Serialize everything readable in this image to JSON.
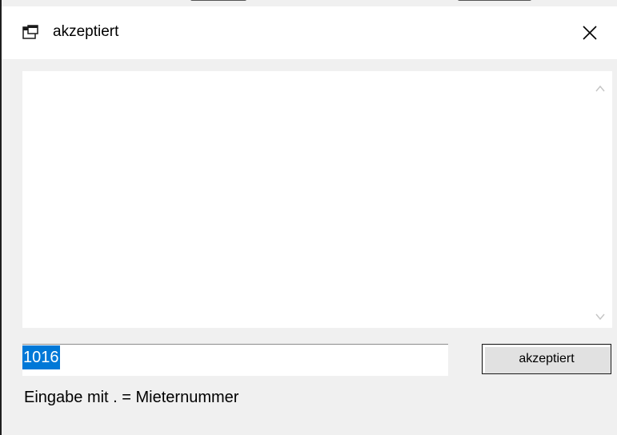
{
  "window": {
    "title": "akzeptiert",
    "app_icon": "application-window-icon",
    "close_icon": "close-icon"
  },
  "list": {
    "items": [],
    "scroll_up_icon": "chevron-up-icon",
    "scroll_down_icon": "chevron-down-icon"
  },
  "input": {
    "value": "1016",
    "selected": true
  },
  "accept_button": {
    "label": "akzeptiert"
  },
  "hint": {
    "text": "Eingabe mit . = Mieternummer"
  },
  "colors": {
    "selection": "#0078d7",
    "background": "#f0f0f0",
    "title_bar": "#ffffff"
  }
}
